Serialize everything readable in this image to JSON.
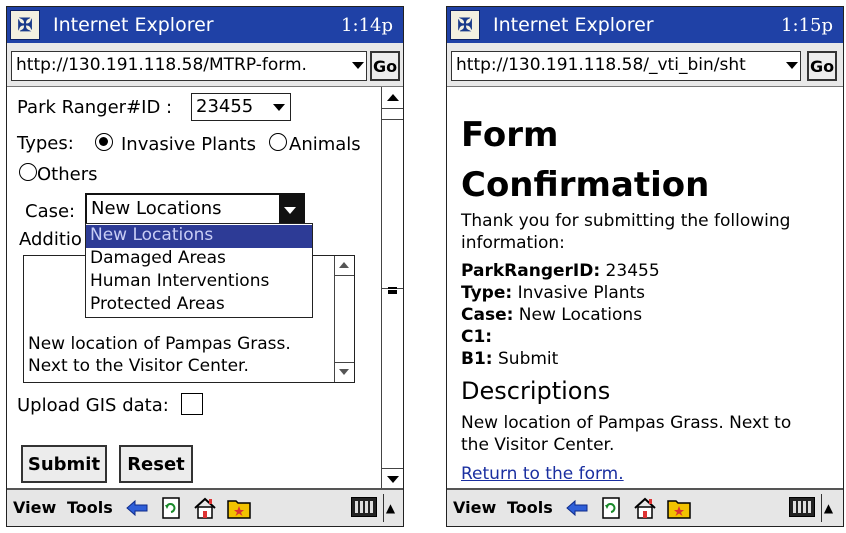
{
  "left": {
    "app_title": "Internet Explorer",
    "time": "1:14p",
    "address": "http://130.191.118.58/MTRP-form.",
    "go_label": "Go",
    "ranger_label": "Park Ranger#ID :",
    "ranger_value": "23455",
    "types_label": "Types:",
    "type_options": [
      "Invasive Plants",
      "Animals",
      "Others"
    ],
    "types_selected": "Invasive Plants",
    "case_label": "Case:",
    "case_value": "New Locations",
    "case_options": [
      "New Locations",
      "Damaged Areas",
      "Human Interventions",
      "Protected Areas"
    ],
    "additional_label_visible": "Additio",
    "description_lines": [
      "New location of Pampas Grass.",
      "Next to the Visitor Center."
    ],
    "upload_label": "Upload GIS data:",
    "submit_label": "Submit",
    "reset_label": "Reset",
    "menu_view": "View",
    "menu_tools": "Tools"
  },
  "right": {
    "app_title": "Internet Explorer",
    "time": "1:15p",
    "address": "http://130.191.118.58/_vti_bin/sht",
    "go_label": "Go",
    "heading_line1": "Form",
    "heading_line2": "Confirmation",
    "intro_line1": "Thank you for submitting the following",
    "intro_line2": "information:",
    "fields": [
      {
        "key": "ParkRangerID:",
        "value": " 23455"
      },
      {
        "key": "Type:",
        "value": " Invasive Plants"
      },
      {
        "key": "Case:",
        "value": " New Locations"
      },
      {
        "key": "C1:",
        "value": ""
      },
      {
        "key": "B1:",
        "value": " Submit"
      }
    ],
    "descriptions_heading": "Descriptions",
    "desc_line1": "New location of Pampas Grass. Next to",
    "desc_line2": "the Visitor Center.",
    "return_link": "Return to the form.",
    "menu_view": "View",
    "menu_tools": "Tools"
  },
  "icons": [
    "start-menu-icon",
    "back-arrow-icon",
    "refresh-icon",
    "home-icon",
    "favorites-icon",
    "keyboard-icon",
    "input-panel-up-icon"
  ],
  "colors": {
    "titlebar": "#1f41a6",
    "selection": "#2d3b96",
    "link": "#1a2fa0"
  }
}
